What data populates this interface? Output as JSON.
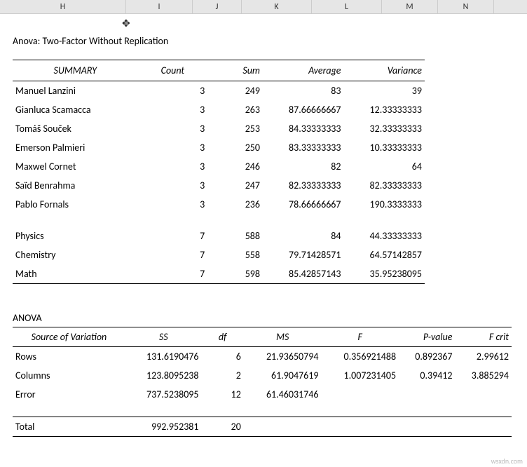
{
  "columns": {
    "h": "H",
    "i": "I",
    "j": "J",
    "k": "K",
    "l": "L",
    "m": "M",
    "n": "N"
  },
  "title": "Anova: Two-Factor Without Replication",
  "summary": {
    "headers": {
      "summary": "SUMMARY",
      "count": "Count",
      "sum": "Sum",
      "average": "Average",
      "variance": "Variance"
    },
    "rows": [
      {
        "name": "Manuel Lanzini",
        "count": "3",
        "sum": "249",
        "average": "83",
        "variance": "39"
      },
      {
        "name": "Gianluca Scamacca",
        "count": "3",
        "sum": "263",
        "average": "87.66666667",
        "variance": "12.33333333"
      },
      {
        "name": "Tomáš Souček",
        "count": "3",
        "sum": "253",
        "average": "84.33333333",
        "variance": "32.33333333"
      },
      {
        "name": "Emerson Palmieri",
        "count": "3",
        "sum": "250",
        "average": "83.33333333",
        "variance": "10.33333333"
      },
      {
        "name": "Maxwel Cornet",
        "count": "3",
        "sum": "246",
        "average": "82",
        "variance": "64"
      },
      {
        "name": "Saïd Benrahma",
        "count": "3",
        "sum": "247",
        "average": "82.33333333",
        "variance": "82.33333333"
      },
      {
        "name": "Pablo Fornals",
        "count": "3",
        "sum": "236",
        "average": "78.66666667",
        "variance": "190.3333333"
      }
    ],
    "cols_rows": [
      {
        "name": "Physics",
        "count": "7",
        "sum": "588",
        "average": "84",
        "variance": "44.33333333"
      },
      {
        "name": "Chemistry",
        "count": "7",
        "sum": "558",
        "average": "79.71428571",
        "variance": "64.57142857"
      },
      {
        "name": "Math",
        "count": "7",
        "sum": "598",
        "average": "85.42857143",
        "variance": "35.95238095"
      }
    ]
  },
  "anova": {
    "label": "ANOVA",
    "headers": {
      "src": "Source of Variation",
      "ss": "SS",
      "df": "df",
      "ms": "MS",
      "f": "F",
      "p": "P-value",
      "fcrit": "F crit"
    },
    "rows": [
      {
        "src": "Rows",
        "ss": "131.6190476",
        "df": "6",
        "ms": "21.93650794",
        "f": "0.356921488",
        "p": "0.892367",
        "fcrit": "2.99612"
      },
      {
        "src": "Columns",
        "ss": "123.8095238",
        "df": "2",
        "ms": "61.9047619",
        "f": "1.007231405",
        "p": "0.39412",
        "fcrit": "3.885294"
      },
      {
        "src": "Error",
        "ss": "737.5238095",
        "df": "12",
        "ms": "61.46031746",
        "f": "",
        "p": "",
        "fcrit": ""
      }
    ],
    "total": {
      "src": "Total",
      "ss": "992.952381",
      "df": "20"
    }
  },
  "watermark": "wsxdn.com"
}
